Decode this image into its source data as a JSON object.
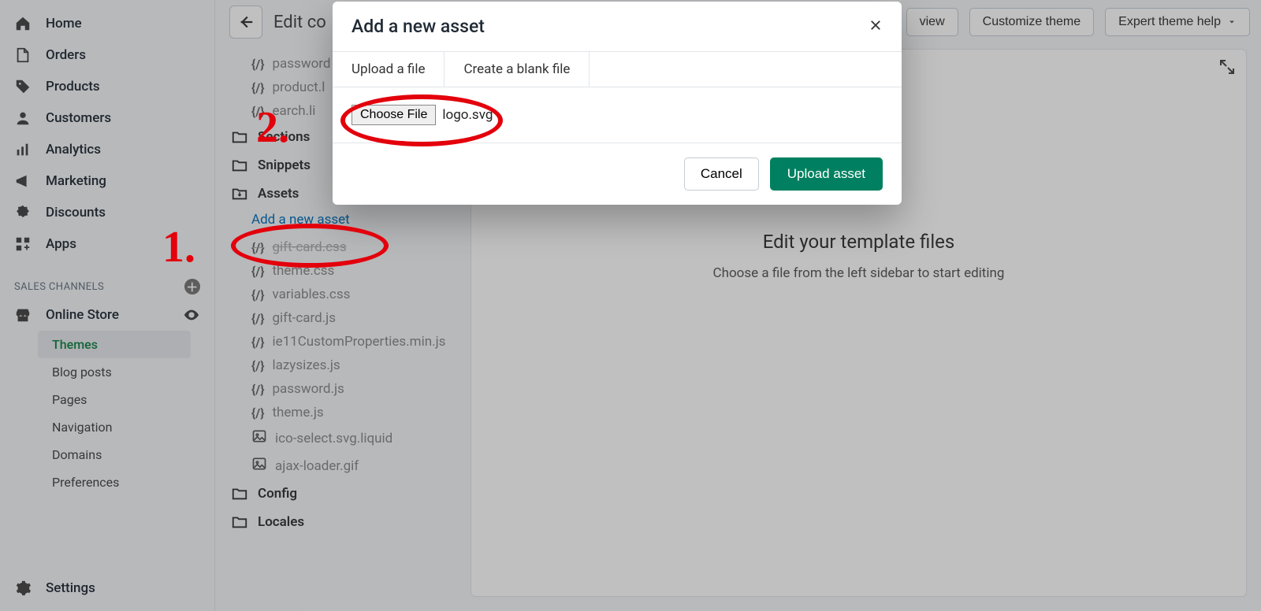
{
  "nav": {
    "home": "Home",
    "orders": "Orders",
    "products": "Products",
    "customers": "Customers",
    "analytics": "Analytics",
    "marketing": "Marketing",
    "discounts": "Discounts",
    "apps": "Apps",
    "sales_channels": "SALES CHANNELS",
    "online_store": "Online Store",
    "subnav": {
      "themes": "Themes",
      "blog": "Blog posts",
      "pages": "Pages",
      "navigation": "Navigation",
      "domains": "Domains",
      "preferences": "Preferences"
    },
    "settings": "Settings"
  },
  "topbar": {
    "title_partial": "Edit co",
    "preview_partial": "view",
    "customize": "Customize theme",
    "expert_help": "Expert theme help"
  },
  "tree": {
    "files_top": {
      "password": "password",
      "product": "product.l",
      "search": "earch.li"
    },
    "sections": "Sections",
    "snippets": "Snippets",
    "assets": "Assets",
    "add_asset": "Add a new asset",
    "assets_files": [
      "gift-card.css",
      "theme.css",
      "variables.css",
      "gift-card.js",
      "ie11CustomProperties.min.js",
      "lazysizes.js",
      "password.js",
      "theme.js",
      "ico-select.svg.liquid",
      "ajax-loader.gif"
    ],
    "config": "Config",
    "locales": "Locales"
  },
  "editor": {
    "heading": "Edit your template files",
    "sub": "Choose a file from the left sidebar to start editing"
  },
  "modal": {
    "title": "Add a new asset",
    "tab_upload": "Upload a file",
    "tab_blank": "Create a blank file",
    "choose_file": "Choose File",
    "chosen_name": "logo.svg",
    "cancel": "Cancel",
    "upload": "Upload asset"
  },
  "annotations": {
    "one": "1.",
    "two": "2."
  }
}
